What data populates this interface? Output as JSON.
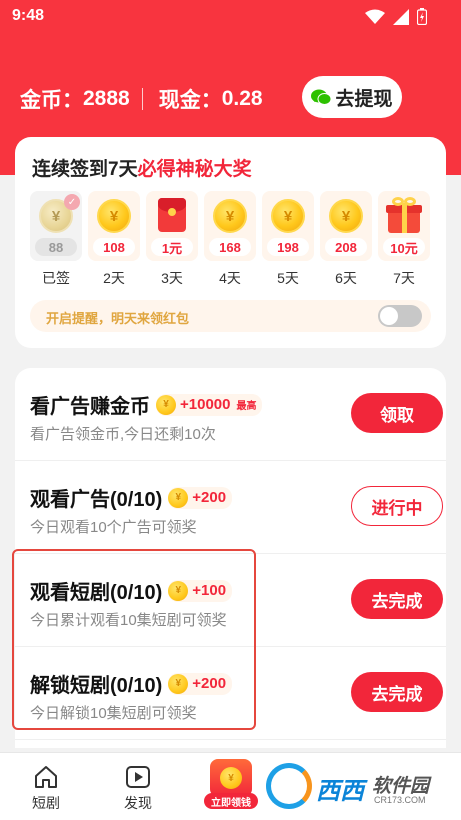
{
  "status_bar": {
    "time": "9:48"
  },
  "wallet": {
    "coins_label": "金币：",
    "coins_value": "2888",
    "cash_label": "现金：",
    "cash_value": "0.28",
    "withdraw_label": "去提现"
  },
  "signin": {
    "title_prefix": "连续签到7天",
    "title_highlight": "必得神秘大奖",
    "days": [
      {
        "value": "88",
        "label": "已签",
        "kind": "coin",
        "signed": true
      },
      {
        "value": "108",
        "label": "2天",
        "kind": "coin"
      },
      {
        "value": "1元",
        "label": "3天",
        "kind": "red-envelope"
      },
      {
        "value": "168",
        "label": "4天",
        "kind": "coin"
      },
      {
        "value": "198",
        "label": "5天",
        "kind": "coin"
      },
      {
        "value": "208",
        "label": "6天",
        "kind": "coin"
      },
      {
        "value": "10元",
        "label": "7天",
        "kind": "gift"
      }
    ],
    "reminder_text": "开启提醒，明天来领红包",
    "reminder_enabled": false
  },
  "tasks": [
    {
      "title": "看广告赚金币",
      "reward": "+10000",
      "reward_tag": "最高",
      "desc": "看广告领金币,今日还剩10次",
      "button": "领取",
      "button_style": "filled"
    },
    {
      "title": "观看广告(0/10)",
      "reward": "+200",
      "desc": "今日观看10个广告可领奖",
      "button": "进行中",
      "button_style": "outline"
    },
    {
      "title": "观看短剧(0/10)",
      "reward": "+100",
      "desc": "今日累计观看10集短剧可领奖",
      "button": "去完成",
      "button_style": "filled"
    },
    {
      "title": "解锁短剧(0/10)",
      "reward": "+200",
      "desc": "今日解锁10集短剧可领奖",
      "button": "去完成",
      "button_style": "filled"
    }
  ],
  "tabbar": {
    "items": [
      {
        "label": "短剧",
        "icon": "home-icon"
      },
      {
        "label": "发现",
        "icon": "play-icon"
      }
    ],
    "center_label": "立即领钱"
  },
  "watermark": {
    "brand": "西西",
    "cn": "软件园",
    "url": "CR173.COM"
  },
  "colors": {
    "brand_red": "#f8343f",
    "accent_red": "#f2263a",
    "coin_gold": "#ffc81c",
    "reminder_text": "#e0a640"
  }
}
